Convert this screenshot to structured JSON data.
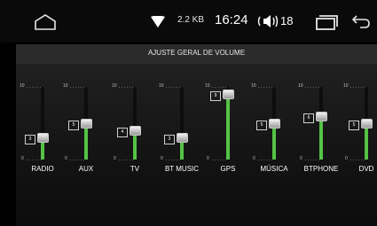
{
  "status_bar": {
    "net_speed": "2.2 KB",
    "clock": "16:24",
    "volume": "18"
  },
  "title": "AJUSTE GERAL DE VOLUME",
  "range": {
    "max": "10",
    "min": "0"
  },
  "sliders": [
    {
      "label": "RADIO",
      "value": 3
    },
    {
      "label": "AUX",
      "value": 5
    },
    {
      "label": "TV",
      "value": 4
    },
    {
      "label": "BT MUSIC",
      "value": 3
    },
    {
      "label": "GPS",
      "value": 9
    },
    {
      "label": "MÚSICA",
      "value": 5
    },
    {
      "label": "BTPHONE",
      "value": 6
    },
    {
      "label": "DVD",
      "value": 5
    }
  ],
  "colors": {
    "fill": "#55c246",
    "background": "#000000"
  }
}
